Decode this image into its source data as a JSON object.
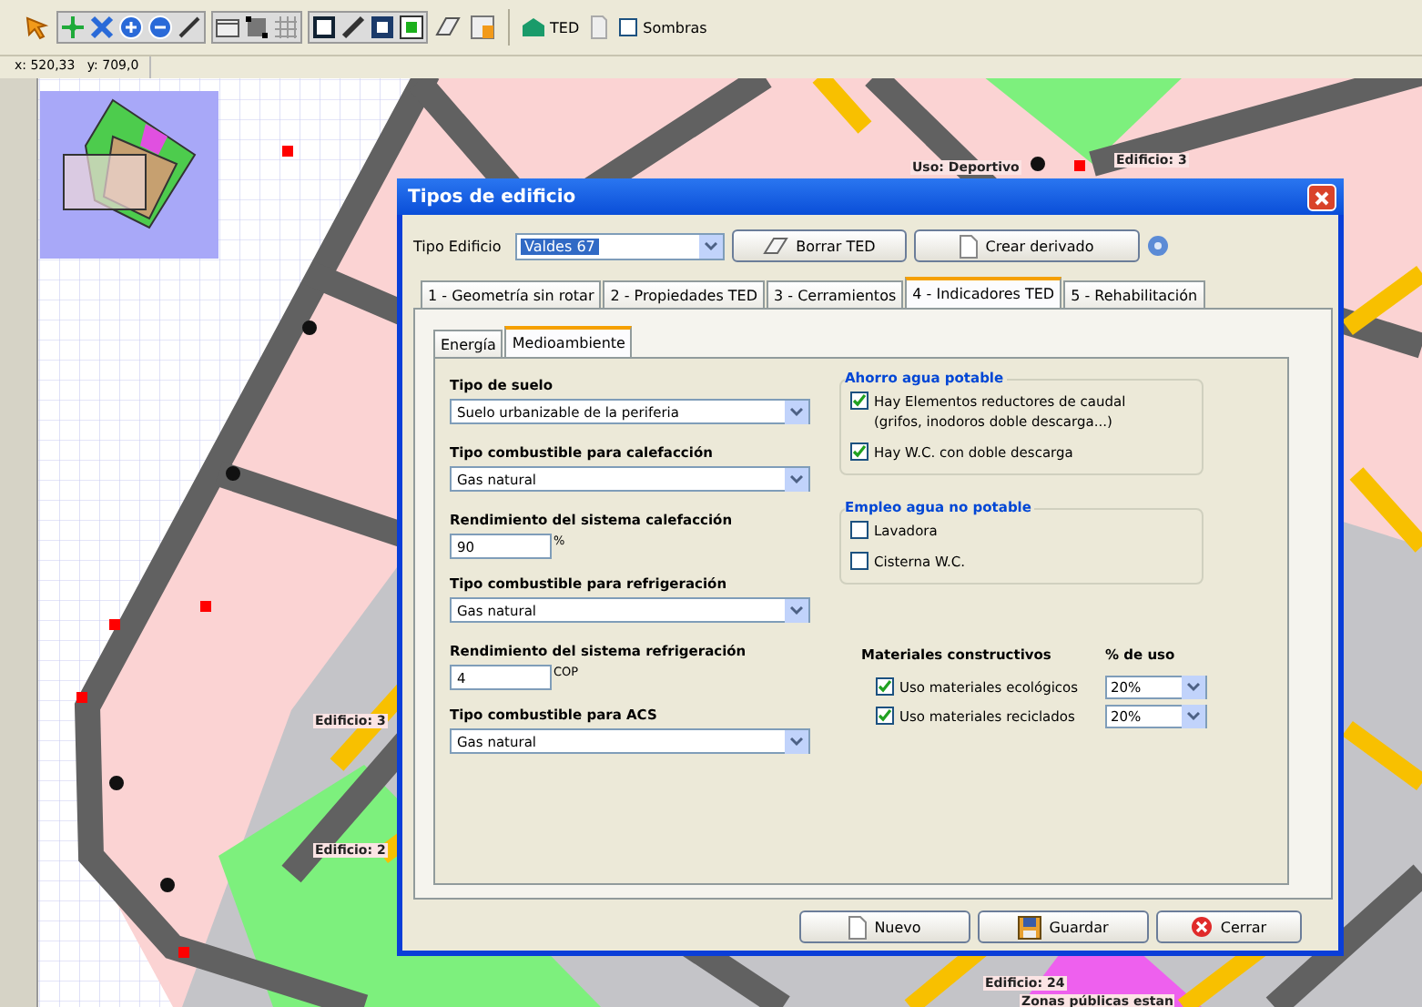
{
  "toolbar": {
    "ted_label": "TED",
    "shadows": {
      "label": "Sombras",
      "checked": false
    }
  },
  "coords": {
    "x": "x: 520,33",
    "y": "y: 709,0"
  },
  "map_labels": [
    "Uso: Deportivo",
    "Edificio: 3",
    "Edificio: 3",
    "Edificio: 2",
    "Edificio: 24",
    "Zonas públicas estan"
  ],
  "dialog": {
    "title": "Tipos de edificio",
    "type_label": "Tipo Edificio",
    "type_value": "Valdes 67",
    "actions": [
      {
        "kind": "erase",
        "label": "Borrar TED"
      },
      {
        "kind": "new",
        "label": "Crear derivado"
      }
    ],
    "tabs": [
      {
        "label": "1 - Geometría sin rotar",
        "selected": false
      },
      {
        "label": "2 - Propiedades TED",
        "selected": false
      },
      {
        "label": "3 - Cerramientos",
        "selected": false
      },
      {
        "label": "4 - Indicadores TED",
        "selected": true
      },
      {
        "label": "5 - Rehabilitación",
        "selected": false
      }
    ],
    "subtabs": [
      {
        "label": "Energía",
        "selected": false
      },
      {
        "label": "Medioambiente",
        "selected": true
      }
    ],
    "fields": [
      {
        "kind": "select",
        "label": "Tipo de suelo",
        "value": "Suelo urbanizable de la periferia"
      },
      {
        "kind": "select",
        "label": "Tipo combustible para calefacción",
        "value": "Gas natural"
      },
      {
        "kind": "number",
        "label": "Rendimiento del sistema calefacción",
        "value": "90",
        "unit": "%"
      },
      {
        "kind": "select",
        "label": "Tipo combustible para refrigeración",
        "value": "Gas natural"
      },
      {
        "kind": "number",
        "label": "Rendimiento del sistema refrigeración",
        "value": "4",
        "unit": "COP"
      },
      {
        "kind": "select",
        "label": "Tipo combustible para ACS",
        "value": "Gas natural"
      }
    ],
    "groups": [
      {
        "title": "Ahorro agua potable",
        "items": [
          {
            "label": "Hay Elementos reductores de caudal",
            "note": "(grifos, inodoros doble descarga...)",
            "checked": true
          },
          {
            "label": "Hay W.C. con doble descarga",
            "checked": true
          }
        ]
      },
      {
        "title": "Empleo agua no potable",
        "items": [
          {
            "label": "Lavadora",
            "checked": false
          },
          {
            "label": "Cisterna W.C.",
            "checked": false
          }
        ]
      }
    ],
    "materials": {
      "title": "Materiales constructivos",
      "pct_header": "% de uso",
      "items": [
        {
          "label": "Uso materiales ecológicos",
          "checked": true,
          "value": "20%"
        },
        {
          "label": "Uso materiales reciclados",
          "checked": true,
          "value": "20%"
        }
      ]
    },
    "buttons": [
      {
        "kind": "new",
        "label": "Nuevo"
      },
      {
        "kind": "save",
        "label": "Guardar"
      },
      {
        "kind": "close",
        "label": "Cerrar"
      }
    ]
  }
}
